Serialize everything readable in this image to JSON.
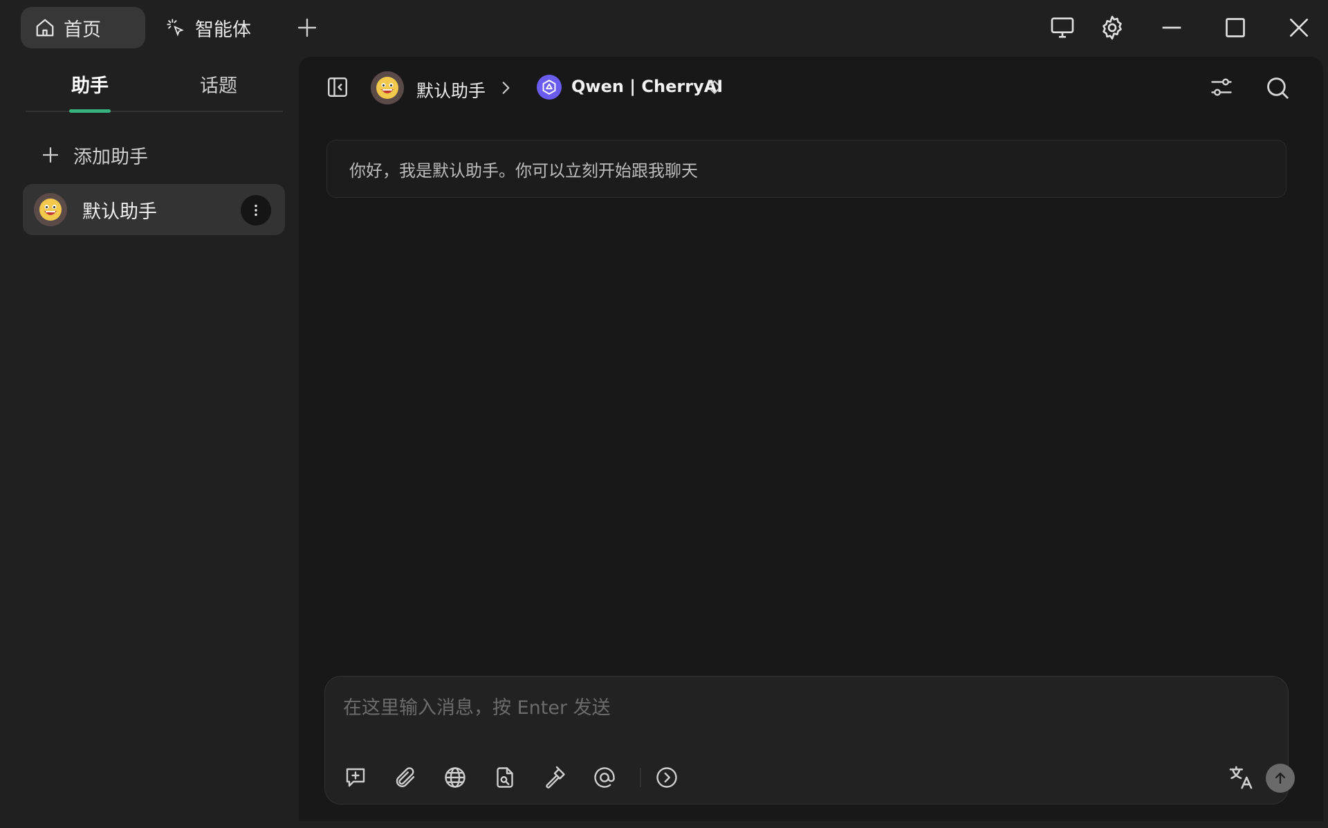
{
  "titlebar": {
    "tabs": [
      {
        "label": "首页",
        "icon": "home-icon",
        "active": true
      },
      {
        "label": "智能体",
        "icon": "sparkle-cursor-icon",
        "active": false
      }
    ],
    "window_controls": [
      "monitor-icon",
      "gear-icon",
      "minimize-icon",
      "maximize-icon",
      "close-icon"
    ]
  },
  "sidebar": {
    "tabs": [
      {
        "label": "助手",
        "active": true
      },
      {
        "label": "话题",
        "active": false
      }
    ],
    "add_assistant_label": "添加助手",
    "assistants": [
      {
        "name": "默认助手",
        "selected": true
      }
    ]
  },
  "header": {
    "assistant_name": "默认助手",
    "model_name": "Qwen | CherryAI"
  },
  "chat": {
    "welcome_message": "你好，我是默认助手。你可以立刻开始跟我聊天"
  },
  "composer": {
    "placeholder": "在这里输入消息，按 Enter 发送",
    "tools": [
      "new-topic-icon",
      "attachment-icon",
      "globe-icon",
      "knowledge-file-icon",
      "hammer-icon",
      "at-mention-icon",
      "expand-more-icon"
    ],
    "translate_icon": "translate-icon",
    "send_icon": "send-arrow-up-icon"
  },
  "colors": {
    "accent": "#36b37e",
    "background": "#202020",
    "panel": "#181818",
    "model_logo": "#6b5cf0"
  }
}
